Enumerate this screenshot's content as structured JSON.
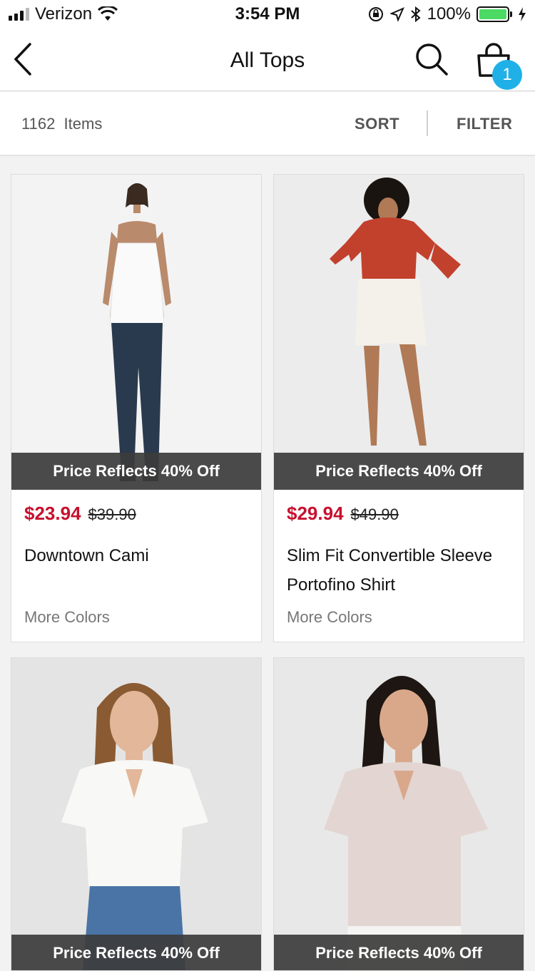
{
  "status_bar": {
    "carrier": "Verizon",
    "time": "3:54 PM",
    "battery": "100%",
    "battery_level": 1.0,
    "icons": [
      "signal-icon",
      "wifi-icon",
      "rotation-lock-icon",
      "location-icon",
      "bluetooth-icon",
      "battery-icon",
      "charging-icon"
    ]
  },
  "nav": {
    "title": "All Tops",
    "cart_count": "1",
    "icons": [
      "back-chevron-icon",
      "search-icon",
      "shopping-bag-icon"
    ]
  },
  "toolbar": {
    "count": "1162",
    "count_label": "Items",
    "sort_label": "SORT",
    "filter_label": "FILTER"
  },
  "colors": {
    "sale_price": "#c8102e",
    "badge": "#1fb0e8",
    "promo_band": "#3c3c3c"
  },
  "products": [
    {
      "promo": "Price Reflects 40% Off",
      "sale_price": "$23.94",
      "original_price": "$39.90",
      "name": "Downtown Cami",
      "more_colors": "More Colors"
    },
    {
      "promo": "Price Reflects 40% Off",
      "sale_price": "$29.94",
      "original_price": "$49.90",
      "name": "Slim Fit Convertible Sleeve Portofino Shirt",
      "more_colors": "More Colors"
    },
    {
      "promo": "Price Reflects 40% Off"
    },
    {
      "promo": "Price Reflects 40% Off"
    }
  ]
}
